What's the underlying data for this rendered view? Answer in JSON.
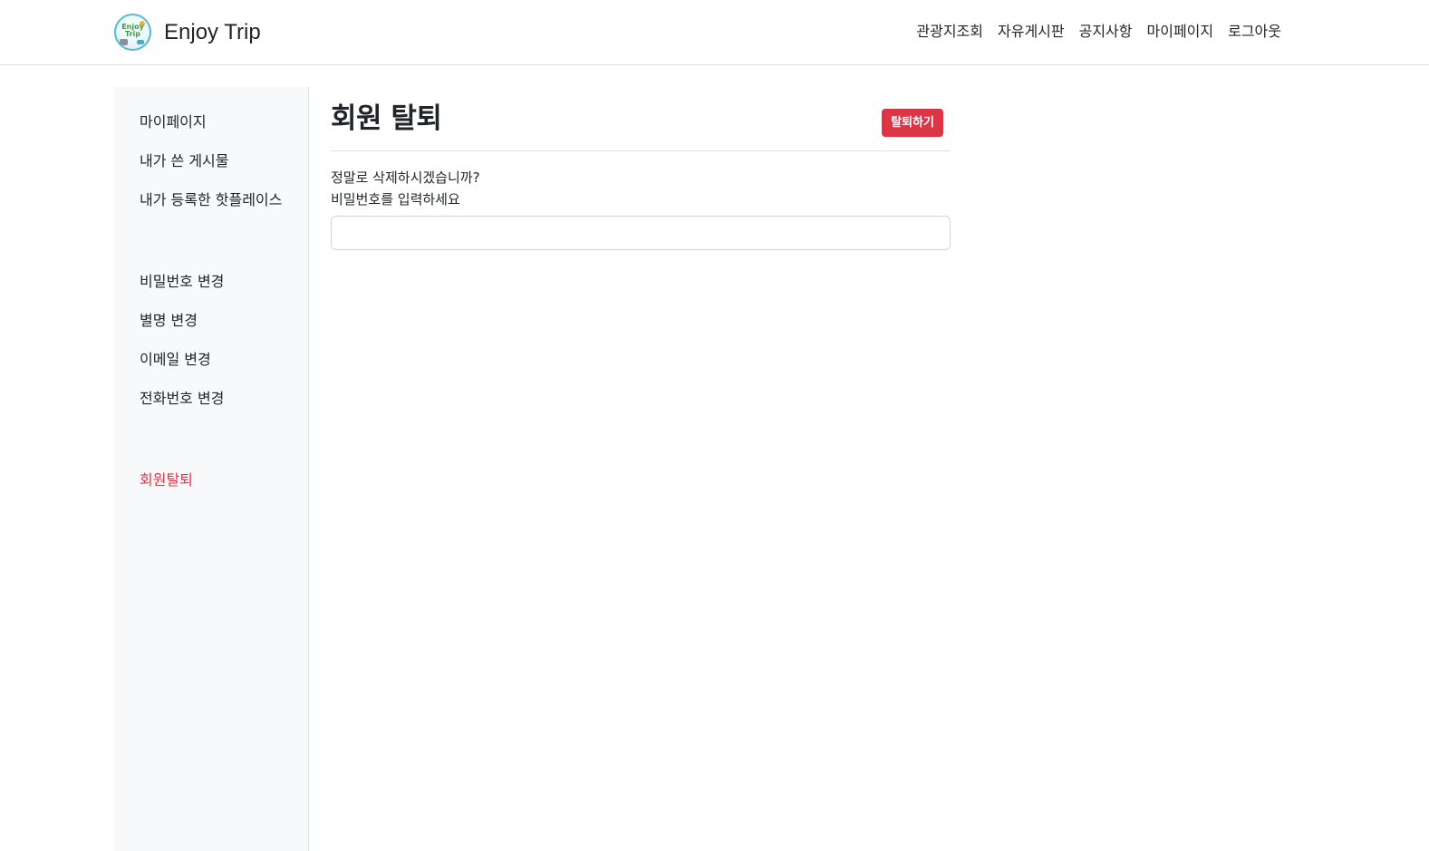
{
  "header": {
    "brand_name": "Enjoy Trip",
    "logo_text": "Enjoy Trip",
    "nav": [
      {
        "label": "관광지조회"
      },
      {
        "label": "자유게시판"
      },
      {
        "label": "공지사항"
      },
      {
        "label": "마이페이지"
      },
      {
        "label": "로그아웃"
      }
    ]
  },
  "sidebar": {
    "items": [
      {
        "label": "마이페이지"
      },
      {
        "label": "내가 쓴 게시물"
      },
      {
        "label": "내가 등록한 핫플레이스"
      },
      {
        "label": "비밀번호 변경"
      },
      {
        "label": "별명 변경"
      },
      {
        "label": "이메일 변경"
      },
      {
        "label": "전화번호 변경"
      },
      {
        "label": "회원탈퇴",
        "active": true
      }
    ]
  },
  "main": {
    "title": "회원 탈퇴",
    "withdraw_button": "탈퇴하기",
    "confirm_question": "정말로 삭제하시겠습니까?",
    "password_prompt": "비밀번호를 입력하세요",
    "password_value": "",
    "password_placeholder": ""
  },
  "colors": {
    "danger": "#dc3545",
    "sidebar_bg": "#f8f9fa",
    "border": "#dee2e6"
  }
}
